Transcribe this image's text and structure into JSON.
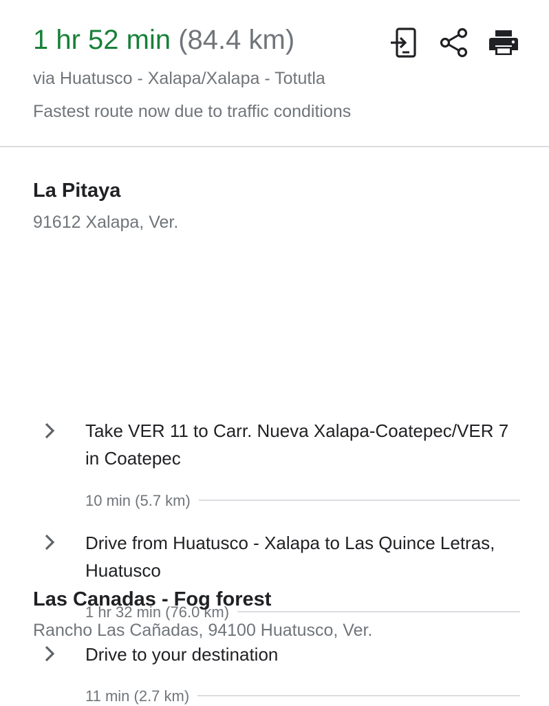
{
  "summary": {
    "duration": "1 hr 52 min",
    "distance": "(84.4 km)",
    "via": "via Huatusco - Xalapa/Xalapa - Totutla",
    "reason": "Fastest route now due to traffic conditions",
    "duration_color": "#188038"
  },
  "actions": {
    "send_to_phone_icon": "send-to-phone-icon",
    "share_icon": "share-icon",
    "print_icon": "print-icon"
  },
  "origin": {
    "name": "La Pitaya",
    "address": "91612 Xalapa, Ver."
  },
  "steps": [
    {
      "text": "Take VER 11 to Carr. Nueva Xalapa-Coatepec/VER 7 in Coatepec",
      "meta": "10 min (5.7 km)"
    },
    {
      "text": "Drive from Huatusco - Xalapa to Las Quince Letras, Huatusco",
      "meta": "1 hr 32 min (76.0 km)"
    },
    {
      "text": "Drive to your destination",
      "meta": "11 min (2.7 km)"
    }
  ],
  "destination": {
    "name": "Las Canadas - Fog forest",
    "address": "Rancho Las Cañadas, 94100 Huatusco, Ver."
  }
}
